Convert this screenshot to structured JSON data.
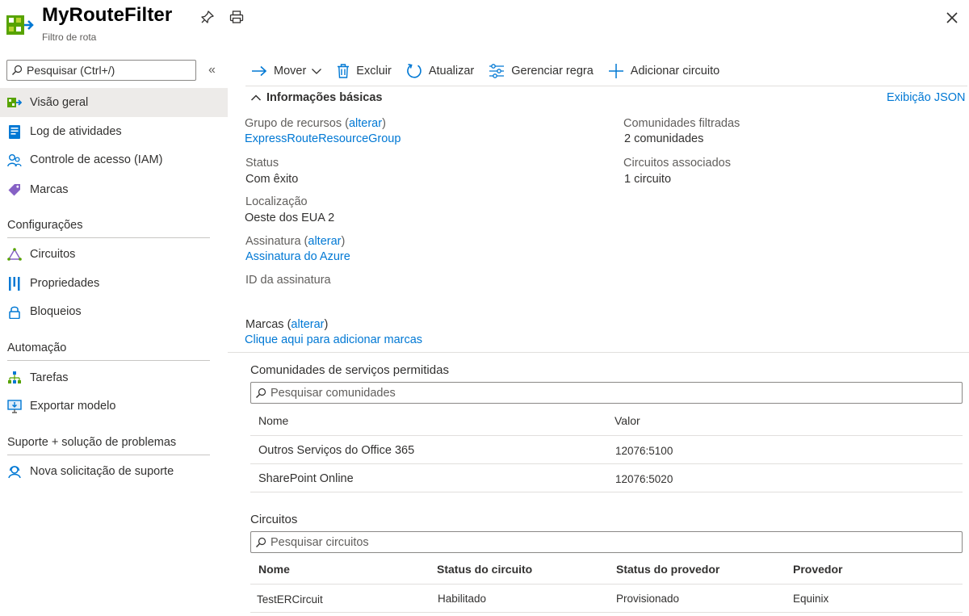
{
  "header": {
    "title": "MyRouteFilter",
    "subtitle": "Filtro de rota"
  },
  "sidebar": {
    "search_placeholder": "Pesquisar (Ctrl+/)",
    "collapse_glyph": "«",
    "items": [
      {
        "label": "Visão geral",
        "icon": "overview-icon",
        "selected": true
      },
      {
        "label": "Log de atividades",
        "icon": "activity-log-icon"
      },
      {
        "label": "Controle de acesso (IAM)",
        "icon": "iam-icon"
      },
      {
        "label": "Marcas",
        "icon": "tag-icon"
      }
    ],
    "sections": [
      {
        "title": "Configurações",
        "items": [
          {
            "label": "Circuitos",
            "icon": "circuit-icon"
          },
          {
            "label": "Propriedades",
            "icon": "properties-icon"
          },
          {
            "label": "Bloqueios",
            "icon": "lock-icon"
          }
        ]
      },
      {
        "title": "Automação",
        "items": [
          {
            "label": "Tarefas",
            "icon": "tasks-icon"
          },
          {
            "label": "Exportar modelo",
            "icon": "export-template-icon"
          }
        ]
      },
      {
        "title": "Suporte + solução de problemas",
        "items": [
          {
            "label": "Nova solicitação de suporte",
            "icon": "support-icon"
          }
        ]
      }
    ]
  },
  "toolbar": {
    "move": "Mover",
    "delete": "Excluir",
    "refresh": "Atualizar",
    "manage_rule": "Gerenciar regra",
    "add_circuit": "Adicionar circuito"
  },
  "essentials": {
    "heading": "Informações básicas",
    "json_view": "Exibição JSON",
    "change": "alterar",
    "resource_group_label": "Grupo de recursos",
    "resource_group_value": "ExpressRouteResourceGroup",
    "status_label": "Status",
    "status_value": "Com êxito",
    "location_label": "Localização",
    "location_value": "Oeste dos EUA 2",
    "subscription_label": "Assinatura",
    "subscription_value": "Assinatura do Azure",
    "subscription_id_label": "ID da assinatura",
    "filtered_communities_label": "Comunidades filtradas",
    "filtered_communities_value": "2 comunidades",
    "associated_circuits_label": "Circuitos associados",
    "associated_circuits_value": "1 circuito",
    "tags_label": "Marcas",
    "tags_value": "Clique aqui para adicionar marcas"
  },
  "communities": {
    "title": "Comunidades de serviços permitidas",
    "search_placeholder": "Pesquisar comunidades",
    "columns": [
      "Nome",
      "Valor"
    ],
    "rows": [
      {
        "name": "Outros Serviços do Office 365",
        "value": "12076:5100"
      },
      {
        "name": "SharePoint Online",
        "value": "12076:5020"
      }
    ]
  },
  "circuits": {
    "title": "Circuitos",
    "search_placeholder": "Pesquisar circuitos",
    "columns": [
      "Nome",
      "Status do circuito",
      "Status do provedor",
      "Provedor"
    ],
    "rows": [
      {
        "name": "TestERCircuit",
        "circuit_status": "Habilitado",
        "provider_status": "Provisionado",
        "provider": "Equinix"
      }
    ]
  },
  "colors": {
    "accent": "#0078d4",
    "selected_bg": "#edebe9",
    "divider": "#e1dfdd"
  }
}
